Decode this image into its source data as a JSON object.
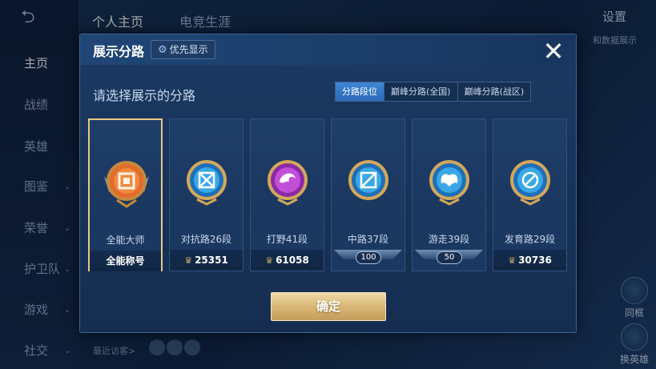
{
  "background": {
    "back_icon": "back-arrow-icon",
    "tabs": [
      "个人主页",
      "电竞生涯"
    ],
    "settings_label": "设置",
    "right_text": "和数据展示",
    "sidebar_items": [
      {
        "label": "主页",
        "active": true
      },
      {
        "label": "战绩",
        "active": false
      },
      {
        "label": "英雄",
        "active": false
      },
      {
        "label": "图鉴",
        "active": false
      },
      {
        "label": "荣誉",
        "active": false
      },
      {
        "label": "护卫队",
        "active": false
      },
      {
        "label": "游戏",
        "active": false
      },
      {
        "label": "社交",
        "active": false
      }
    ],
    "bottom_text": "最近访客>",
    "right_buttons": [
      "同框",
      "换英雄"
    ]
  },
  "modal": {
    "title": "展示分路",
    "priority_label": "优先显示",
    "priority_icon": "gear-icon",
    "close_icon": "close-icon",
    "subtitle": "请选择展示的分路",
    "tabs": [
      {
        "label": "分路段位",
        "active": true
      },
      {
        "label": "巅峰分路(全国)",
        "active": false
      },
      {
        "label": "巅峰分路(战区)",
        "active": false
      }
    ],
    "cards": [
      {
        "name": "全能大师",
        "footer": "全能称号",
        "peak": "",
        "rank": "",
        "selected": true,
        "medal_color": "#d65a2a",
        "emblem": "square-spiral"
      },
      {
        "name": "对抗路26段",
        "footer": "",
        "peak": "25351",
        "rank": "",
        "selected": false,
        "medal_color": "#3aa8e6",
        "emblem": "crossed-swords"
      },
      {
        "name": "打野41段",
        "footer": "",
        "peak": "61058",
        "rank": "",
        "selected": false,
        "medal_color": "#b93fd2",
        "emblem": "dragon"
      },
      {
        "name": "中路37段",
        "footer": "",
        "peak": "",
        "rank": "100",
        "selected": false,
        "medal_color": "#3aa8e6",
        "emblem": "slash-square"
      },
      {
        "name": "游走39段",
        "footer": "",
        "peak": "",
        "rank": "50",
        "selected": false,
        "medal_color": "#3aa8e6",
        "emblem": "wings"
      },
      {
        "name": "发育路29段",
        "footer": "",
        "peak": "30736",
        "rank": "",
        "selected": false,
        "medal_color": "#3aa8e6",
        "emblem": "no-sign"
      }
    ],
    "peak_icon": "peak-crown-icon",
    "confirm_label": "确定"
  },
  "colors": {
    "selected_border": "#e8c98a",
    "active_tab": "#3f86d6",
    "confirm_gold": "#d9b876"
  }
}
